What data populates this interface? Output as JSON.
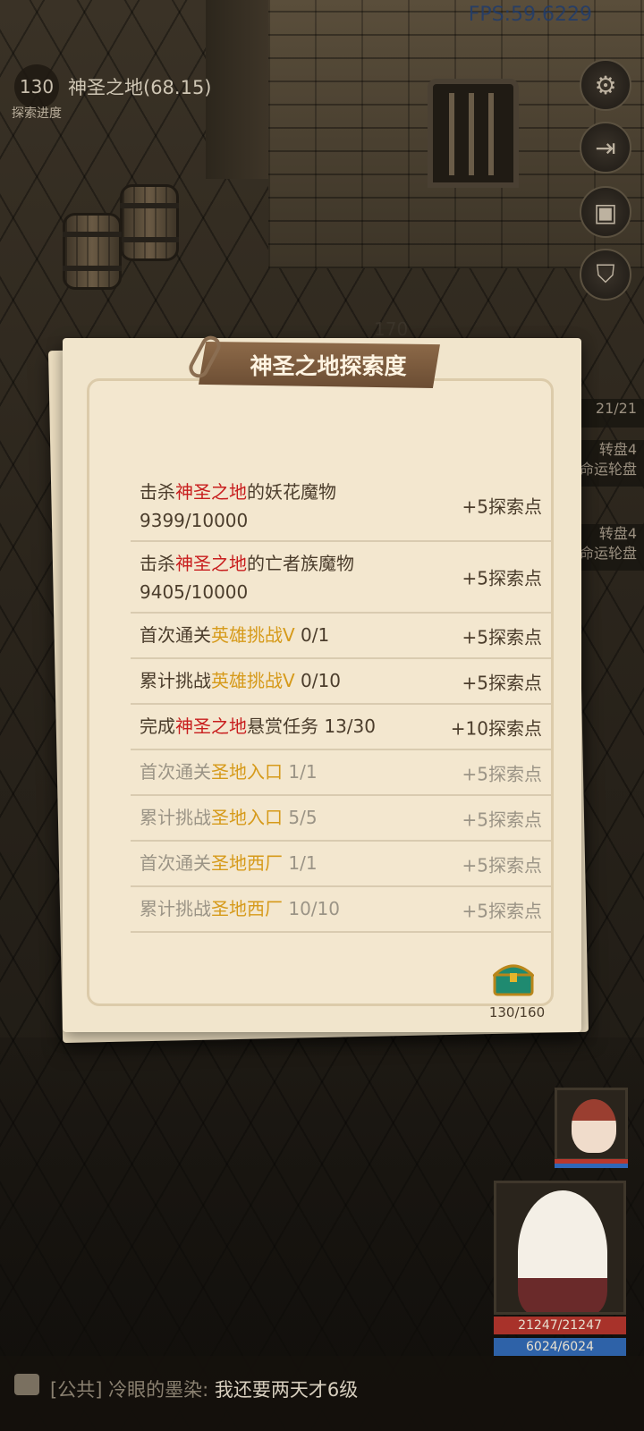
{
  "hud": {
    "fps": "FPS:59.6229",
    "area_level": "130",
    "area_name": "神圣之地(68.15)",
    "area_progress_label": "探索进度"
  },
  "side_buttons": [
    "gear-icon",
    "exit-icon",
    "chest-icon",
    "shield-icon"
  ],
  "side_panel": {
    "counter": "21/21",
    "items": [
      {
        "line1": "转盘4",
        "line2": "命运轮盘"
      },
      {
        "line1": "转盘4",
        "line2": "命运轮盘"
      }
    ]
  },
  "world": {
    "enemy_level": "170"
  },
  "party": {
    "hp": "21247/21247",
    "mp": "6024/6024"
  },
  "dialog": {
    "title": "神圣之地探索度",
    "rows": [
      {
        "pre": "击杀",
        "hl": "神圣之地",
        "hl_color": "#c81e1e",
        "post": "的妖花魔物",
        "progress": "9399/10000",
        "reward": "+5探索点",
        "done": false
      },
      {
        "pre": "击杀",
        "hl": "神圣之地",
        "hl_color": "#c81e1e",
        "post": "的亡者族魔物",
        "progress": "9405/10000",
        "reward": "+5探索点",
        "done": false
      },
      {
        "pre": "首次通关",
        "hl": "英雄挑战Ⅴ",
        "hl_color": "#d69a1a",
        "post": " 0/1",
        "reward": "+5探索点",
        "done": false
      },
      {
        "pre": "累计挑战",
        "hl": "英雄挑战Ⅴ",
        "hl_color": "#d69a1a",
        "post": " 0/10",
        "reward": "+5探索点",
        "done": false
      },
      {
        "pre": "完成",
        "hl": "神圣之地",
        "hl_color": "#c81e1e",
        "post": "悬赏任务 13/30",
        "reward": "+10探索点",
        "done": false
      },
      {
        "pre": "首次通关",
        "hl": "圣地入口",
        "hl_color": "#d69a1a",
        "post": " 1/1",
        "reward": "+5探索点",
        "done": true
      },
      {
        "pre": "累计挑战",
        "hl": "圣地入口",
        "hl_color": "#d69a1a",
        "post": " 5/5",
        "reward": "+5探索点",
        "done": true
      },
      {
        "pre": "首次通关",
        "hl": "圣地西厂",
        "hl_color": "#d69a1a",
        "post": " 1/1",
        "reward": "+5探索点",
        "done": true
      },
      {
        "pre": "累计挑战",
        "hl": "圣地西厂",
        "hl_color": "#d69a1a",
        "post": " 10/10",
        "reward": "+5探索点",
        "done": true
      }
    ],
    "reward_icon": "treasure-chest-icon",
    "reward_count": "130/160"
  },
  "chat": {
    "channel": "[公共]",
    "user": "冷眼的墨染:",
    "message": "我还要两天才6级"
  }
}
